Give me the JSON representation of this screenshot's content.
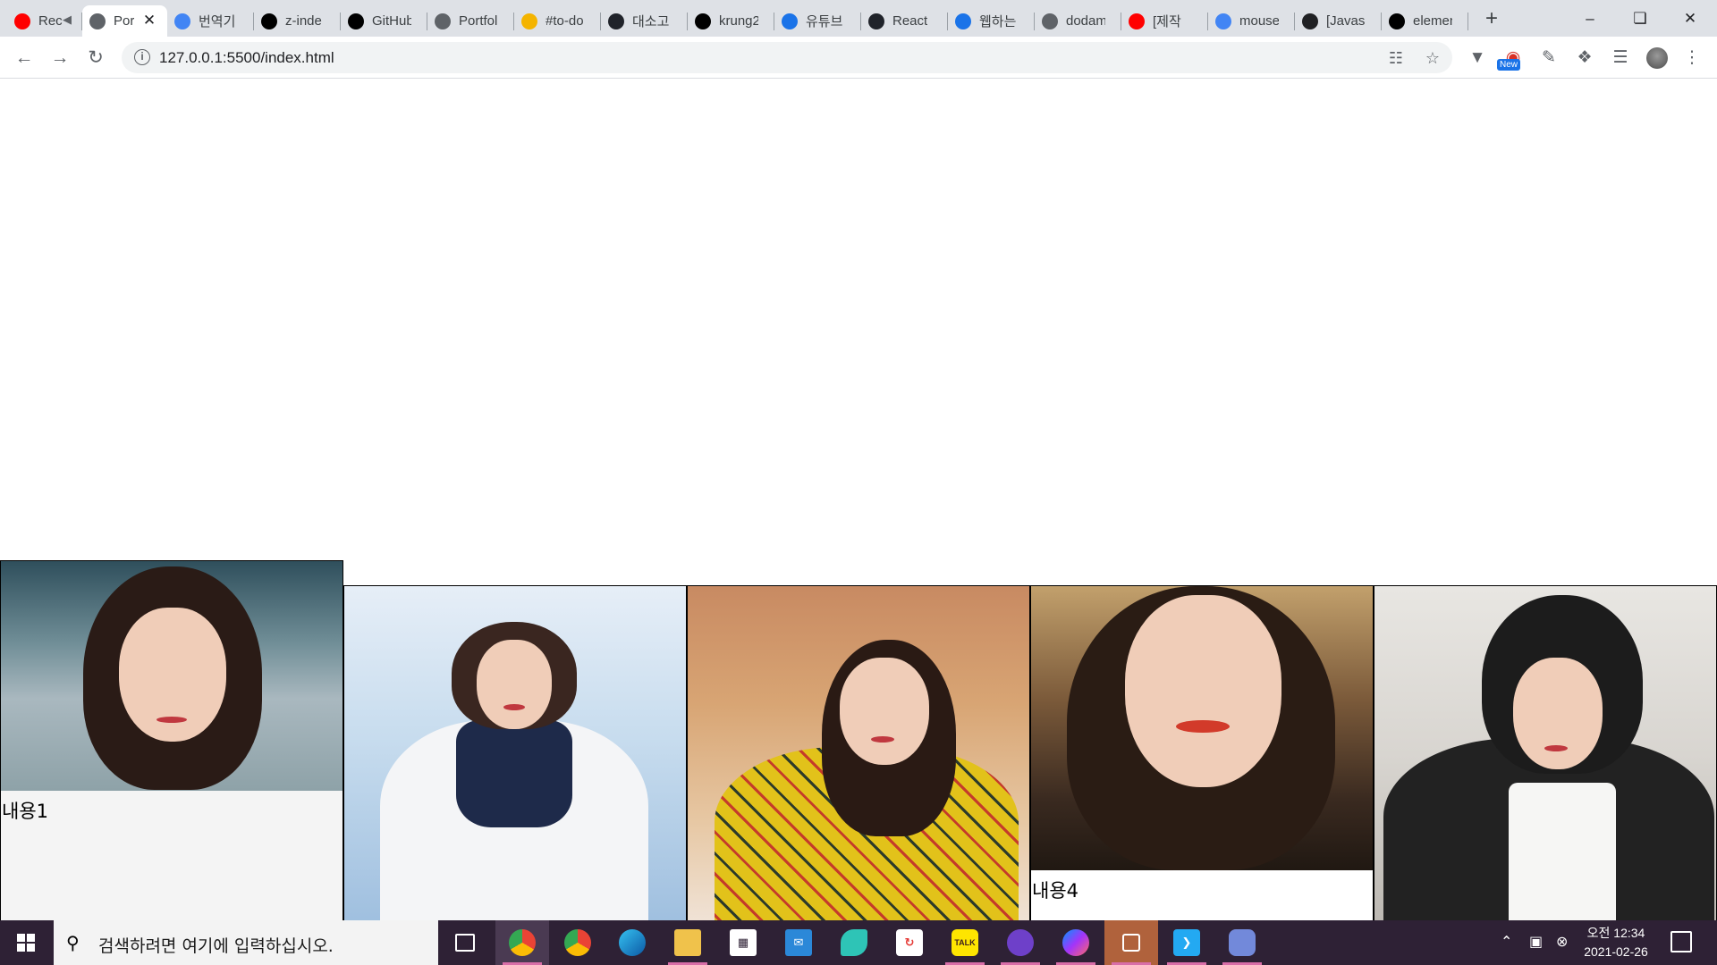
{
  "browser": {
    "tabs": [
      {
        "title": "Rec",
        "favicon": "youtube-icon",
        "color": "#ff0000",
        "audio": true
      },
      {
        "title": "Por",
        "favicon": "globe-icon",
        "color": "#5f6368",
        "active": true
      },
      {
        "title": "번역기",
        "favicon": "google-icon",
        "color": "#4285f4"
      },
      {
        "title": "z-inde",
        "favicon": "notion-icon",
        "color": "#000000"
      },
      {
        "title": "GitHub",
        "favicon": "github-icon",
        "color": "#000000"
      },
      {
        "title": "Portfol",
        "favicon": "globe-icon",
        "color": "#5f6368"
      },
      {
        "title": "#to-do",
        "favicon": "warning-icon",
        "color": "#f4b400"
      },
      {
        "title": "대소고",
        "favicon": "react-icon",
        "color": "#20232a"
      },
      {
        "title": "krung2",
        "favicon": "github-icon",
        "color": "#000000"
      },
      {
        "title": "유튜브",
        "favicon": "h-icon",
        "color": "#1a73e8"
      },
      {
        "title": "React",
        "favicon": "react-icon",
        "color": "#20232a"
      },
      {
        "title": "웹하는",
        "favicon": "h-icon",
        "color": "#1a73e8"
      },
      {
        "title": "dodam",
        "favicon": "globe-icon",
        "color": "#5f6368"
      },
      {
        "title": "[제작",
        "favicon": "youtube-icon",
        "color": "#ff0000"
      },
      {
        "title": "mouse",
        "favicon": "google-icon",
        "color": "#4285f4"
      },
      {
        "title": "[Javas",
        "favicon": "dots-icon",
        "color": "#202124"
      },
      {
        "title": "elemen",
        "favicon": "notion-icon",
        "color": "#000000"
      }
    ],
    "url": "127.0.0.1:5500/index.html",
    "extension_badge": "New"
  },
  "page": {
    "cards": [
      {
        "caption": "내용1"
      },
      {
        "caption": ""
      },
      {
        "caption": ""
      },
      {
        "caption": "내용4"
      },
      {
        "caption": ""
      }
    ]
  },
  "taskbar": {
    "search_placeholder": "검색하려면 여기에 입력하십시오.",
    "apps": [
      "task-view-icon",
      "chrome-icon",
      "chrome-canary-icon",
      "edge-icon",
      "file-explorer-icon",
      "store-icon",
      "mail-icon",
      "app-icon",
      "sync-icon",
      "kakaotalk-icon",
      "github-desktop-icon",
      "messenger-icon",
      "app-icon",
      "vscode-icon",
      "discord-icon"
    ],
    "kakaotalk_label": "TALK",
    "time": "오전 12:34",
    "date": "2021-02-26"
  }
}
